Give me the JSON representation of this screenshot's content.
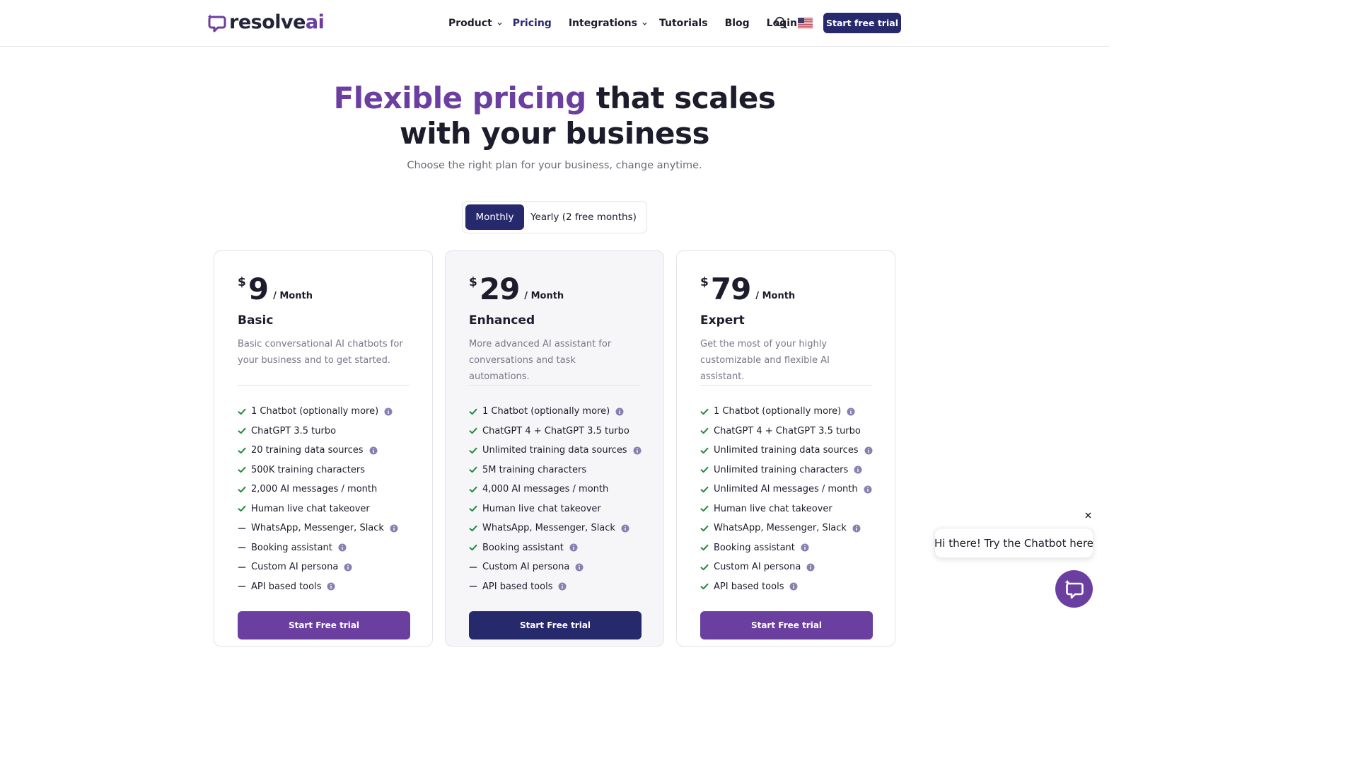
{
  "brand": {
    "name": "resolve",
    "name_accent": "ai"
  },
  "nav": {
    "items": [
      {
        "label": "Product",
        "dropdown": true,
        "active": false
      },
      {
        "label": "Pricing",
        "dropdown": false,
        "active": true
      },
      {
        "label": "Integrations",
        "dropdown": true,
        "active": false
      },
      {
        "label": "Tutorials",
        "dropdown": false,
        "active": false
      },
      {
        "label": "Blog",
        "dropdown": false,
        "active": false
      },
      {
        "label": "Login",
        "dropdown": false,
        "active": false
      }
    ],
    "cta_label": "Start free trial"
  },
  "hero": {
    "title_highlight": "Flexible pricing",
    "title_rest_line1": " that scales",
    "title_line2": "with your business",
    "subtitle": "Choose the right plan for your business, change anytime."
  },
  "billing_toggle": {
    "monthly_label": "Monthly",
    "yearly_label": "Yearly (2 free months)",
    "selected": "monthly"
  },
  "plans": [
    {
      "currency": "$",
      "price": "9",
      "period": "/ Month",
      "name": "Basic",
      "description": "Basic conversational AI chatbots for your business and to get started.",
      "cta_label": "Start Free trial",
      "features": [
        {
          "label": "1 Chatbot (optionally more)",
          "included": true,
          "info": true
        },
        {
          "label": "ChatGPT 3.5 turbo",
          "included": true,
          "info": false
        },
        {
          "label": "20 training data sources",
          "included": true,
          "info": true
        },
        {
          "label": "500K training characters",
          "included": true,
          "info": false
        },
        {
          "label": "2,000 AI messages / month",
          "included": true,
          "info": false
        },
        {
          "label": "Human live chat takeover",
          "included": true,
          "info": false
        },
        {
          "label": "WhatsApp, Messenger, Slack",
          "included": false,
          "info": true
        },
        {
          "label": "Booking assistant",
          "included": false,
          "info": true
        },
        {
          "label": "Custom AI persona",
          "included": false,
          "info": true
        },
        {
          "label": "API based tools",
          "included": false,
          "info": true
        }
      ]
    },
    {
      "currency": "$",
      "price": "29",
      "period": "/ Month",
      "name": "Enhanced",
      "description": "More advanced AI assistant for conversations and task automations.",
      "cta_label": "Start Free trial",
      "features": [
        {
          "label": "1 Chatbot (optionally more)",
          "included": true,
          "info": true
        },
        {
          "label": "ChatGPT 4 + ChatGPT 3.5 turbo",
          "included": true,
          "info": false
        },
        {
          "label": "Unlimited training data sources",
          "included": true,
          "info": true
        },
        {
          "label": "5M training characters",
          "included": true,
          "info": false
        },
        {
          "label": "4,000 AI messages / month",
          "included": true,
          "info": false
        },
        {
          "label": "Human live chat takeover",
          "included": true,
          "info": false
        },
        {
          "label": "WhatsApp, Messenger, Slack",
          "included": true,
          "info": true
        },
        {
          "label": "Booking assistant",
          "included": true,
          "info": true
        },
        {
          "label": "Custom AI persona",
          "included": false,
          "info": true
        },
        {
          "label": "API based tools",
          "included": false,
          "info": true
        }
      ]
    },
    {
      "currency": "$",
      "price": "79",
      "period": "/ Month",
      "name": "Expert",
      "description": "Get the most of your highly customizable and flexible AI assistant.",
      "cta_label": "Start Free trial",
      "features": [
        {
          "label": "1 Chatbot (optionally more)",
          "included": true,
          "info": true
        },
        {
          "label": "ChatGPT 4 + ChatGPT 3.5 turbo",
          "included": true,
          "info": false
        },
        {
          "label": "Unlimited training data sources",
          "included": true,
          "info": true
        },
        {
          "label": "Unlimited training characters",
          "included": true,
          "info": true
        },
        {
          "label": "Unlimited AI messages / month",
          "included": true,
          "info": true
        },
        {
          "label": "Human live chat takeover",
          "included": true,
          "info": false
        },
        {
          "label": "WhatsApp, Messenger, Slack",
          "included": true,
          "info": true
        },
        {
          "label": "Booking assistant",
          "included": true,
          "info": true
        },
        {
          "label": "Custom AI persona",
          "included": true,
          "info": true
        },
        {
          "label": "API based tools",
          "included": true,
          "info": true
        }
      ]
    }
  ],
  "chat_widget": {
    "greeting": "Hi there! Try the Chatbot here"
  },
  "colors": {
    "brand_purple": "#6b3fa0",
    "navy": "#27296d",
    "check_green": "#1f8a3b",
    "info_grey": "#8a7fb0"
  }
}
